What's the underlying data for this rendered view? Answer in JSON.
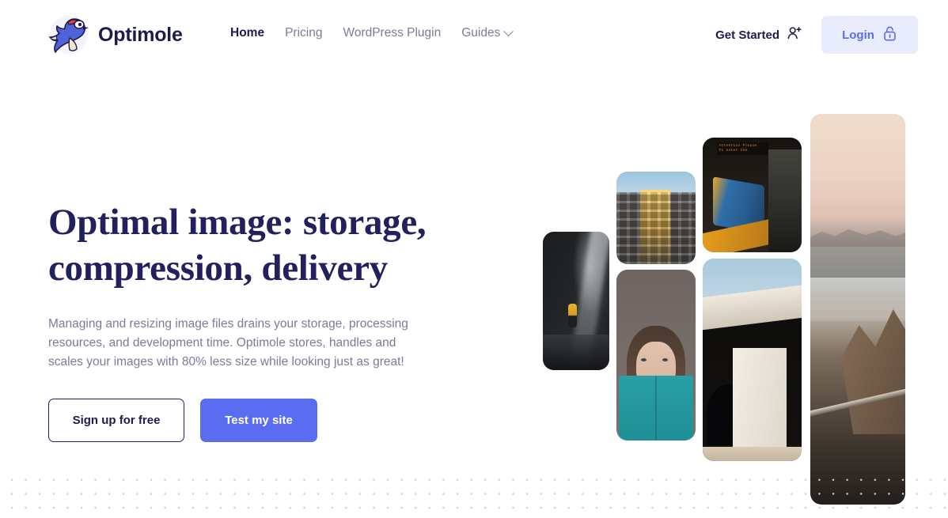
{
  "brand": {
    "name": "Optimole",
    "logo_icon": "optimole-mole-logo-icon"
  },
  "nav": {
    "items": [
      {
        "label": "Home",
        "active": true,
        "has_dropdown": false
      },
      {
        "label": "Pricing",
        "active": false,
        "has_dropdown": false
      },
      {
        "label": "WordPress Plugin",
        "active": false,
        "has_dropdown": false
      },
      {
        "label": "Guides",
        "active": false,
        "has_dropdown": true
      }
    ]
  },
  "header_actions": {
    "get_started_label": "Get Started",
    "get_started_icon": "user-plus-icon",
    "login_label": "Login",
    "login_icon": "lock-icon"
  },
  "hero": {
    "title_line1": "Optimal image: storage,",
    "title_line2": "compression, delivery",
    "subtitle": "Managing and resizing image files drains your storage, processing resources, and development time. Optimole stores, handles and scales your images with 80% less size while looking just as great!",
    "primary_cta": "Test my site",
    "secondary_cta": "Sign up for free"
  },
  "collage": {
    "images": [
      {
        "name": "cave-explorer-photo",
        "alt": "Person in yellow jacket inside a dark cave"
      },
      {
        "name": "building-facade-photo",
        "alt": "Apartment building facade lit by golden sunlight"
      },
      {
        "name": "woman-reading-photo",
        "alt": "Woman holding a teal book over her face"
      },
      {
        "name": "train-station-photo",
        "alt": "Blue and yellow train at a station platform"
      },
      {
        "name": "concrete-bridge-photo",
        "alt": "Concrete bridge overpass against blue sky"
      },
      {
        "name": "coastal-sunset-photo",
        "alt": "Coastal cliffs and beach at sunset with a road"
      }
    ]
  },
  "colors": {
    "brand_navy": "#22205e",
    "accent_blue": "#5a6df0",
    "login_bg": "#e9ecfd",
    "muted_text": "#7b7b99",
    "dot_grid": "#cfcfd4",
    "page_bg": "#ffffff"
  }
}
